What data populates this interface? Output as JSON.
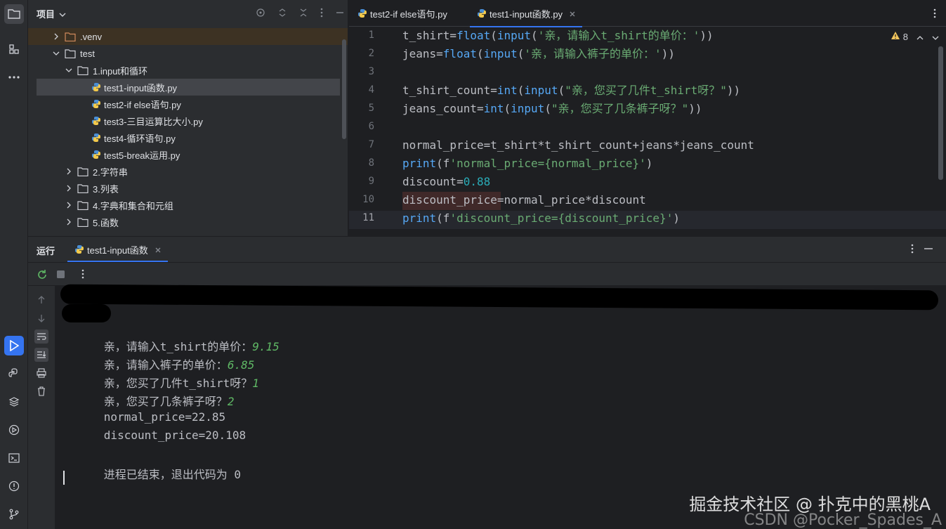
{
  "project_panel": {
    "title": "项目",
    "tree": [
      {
        "label": ".venv",
        "type": "folder"
      },
      {
        "label": "test",
        "type": "folder"
      },
      {
        "label": "1.input和循环",
        "type": "folder"
      },
      {
        "label": "test1-input函数.py",
        "type": "py"
      },
      {
        "label": "test2-if else语句.py",
        "type": "py"
      },
      {
        "label": "test3-三目运算比大小.py",
        "type": "py"
      },
      {
        "label": "test4-循环语句.py",
        "type": "py"
      },
      {
        "label": "test5-break运用.py",
        "type": "py"
      },
      {
        "label": "2.字符串",
        "type": "folder"
      },
      {
        "label": "3.列表",
        "type": "folder"
      },
      {
        "label": "4.字典和集合和元组",
        "type": "folder"
      },
      {
        "label": "5.函数",
        "type": "folder"
      }
    ]
  },
  "editor": {
    "tabs": [
      {
        "label": "test2-if else语句.py"
      },
      {
        "label": "test1-input函数.py"
      }
    ],
    "warning_count": "8",
    "line_numbers": [
      "1",
      "2",
      "3",
      "4",
      "5",
      "6",
      "7",
      "8",
      "9",
      "10",
      "11"
    ],
    "lines": [
      "t_shirt=float(input('亲，请输入t_shirt的单价：'))",
      "jeans=float(input('亲，请输入裤子的单价：'))",
      "",
      "t_shirt_count=int(input(\"亲，您买了几件t_shirt呀？\"))",
      "jeans_count=int(input(\"亲，您买了几条裤子呀？\"))",
      "",
      "normal_price=t_shirt*t_shirt_count+jeans*jeans_count",
      "print(f'normal_price={normal_price}')",
      "discount=0.88",
      "discount_price=normal_price*discount",
      "print(f'discount_price={discount_price}')"
    ]
  },
  "run_panel": {
    "title": "运行",
    "tab_label": "test1-input函数",
    "output": [
      {
        "prompt": "亲，请输入t_shirt的单价：",
        "input": "9.15"
      },
      {
        "prompt": "亲，请输入裤子的单价：",
        "input": "6.85"
      },
      {
        "prompt": "亲，您买了几件t_shirt呀？",
        "input": "1"
      },
      {
        "prompt": "亲，您买了几条裤子呀？",
        "input": "2"
      },
      {
        "prompt": "normal_price=22.85",
        "input": ""
      },
      {
        "prompt": "discount_price=20.108",
        "input": ""
      },
      {
        "prompt": "",
        "input": ""
      },
      {
        "prompt": "进程已结束，退出代码为 0",
        "input": ""
      }
    ]
  },
  "watermark": {
    "line1": "掘金技术社区 @ 扑克中的黑桃A",
    "line2": "CSDN @Pocker_Spades_A"
  },
  "colors": {
    "accent": "#3574f0",
    "string": "#6aab73",
    "function": "#56a8f5",
    "number": "#2aacb8",
    "input_value": "#5fb865"
  }
}
